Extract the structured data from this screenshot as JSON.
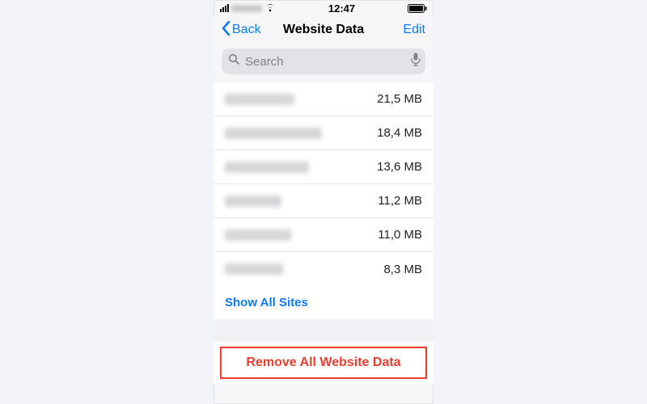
{
  "statusbar": {
    "time": "12:47"
  },
  "navbar": {
    "back_label": "Back",
    "title": "Website Data",
    "edit_label": "Edit"
  },
  "search": {
    "placeholder": "Search"
  },
  "sites": [
    {
      "size": "21,5 MB",
      "blur_w": 86
    },
    {
      "size": "18,4 MB",
      "blur_w": 120
    },
    {
      "size": "13,6 MB",
      "blur_w": 104
    },
    {
      "size": "11,2 MB",
      "blur_w": 70
    },
    {
      "size": "11,0 MB",
      "blur_w": 82
    },
    {
      "size": "8,3 MB",
      "blur_w": 72
    }
  ],
  "actions": {
    "show_all": "Show All Sites",
    "remove_all": "Remove All Website Data"
  },
  "colors": {
    "accent": "#0a7aff",
    "destructive": "#f03b2d"
  }
}
